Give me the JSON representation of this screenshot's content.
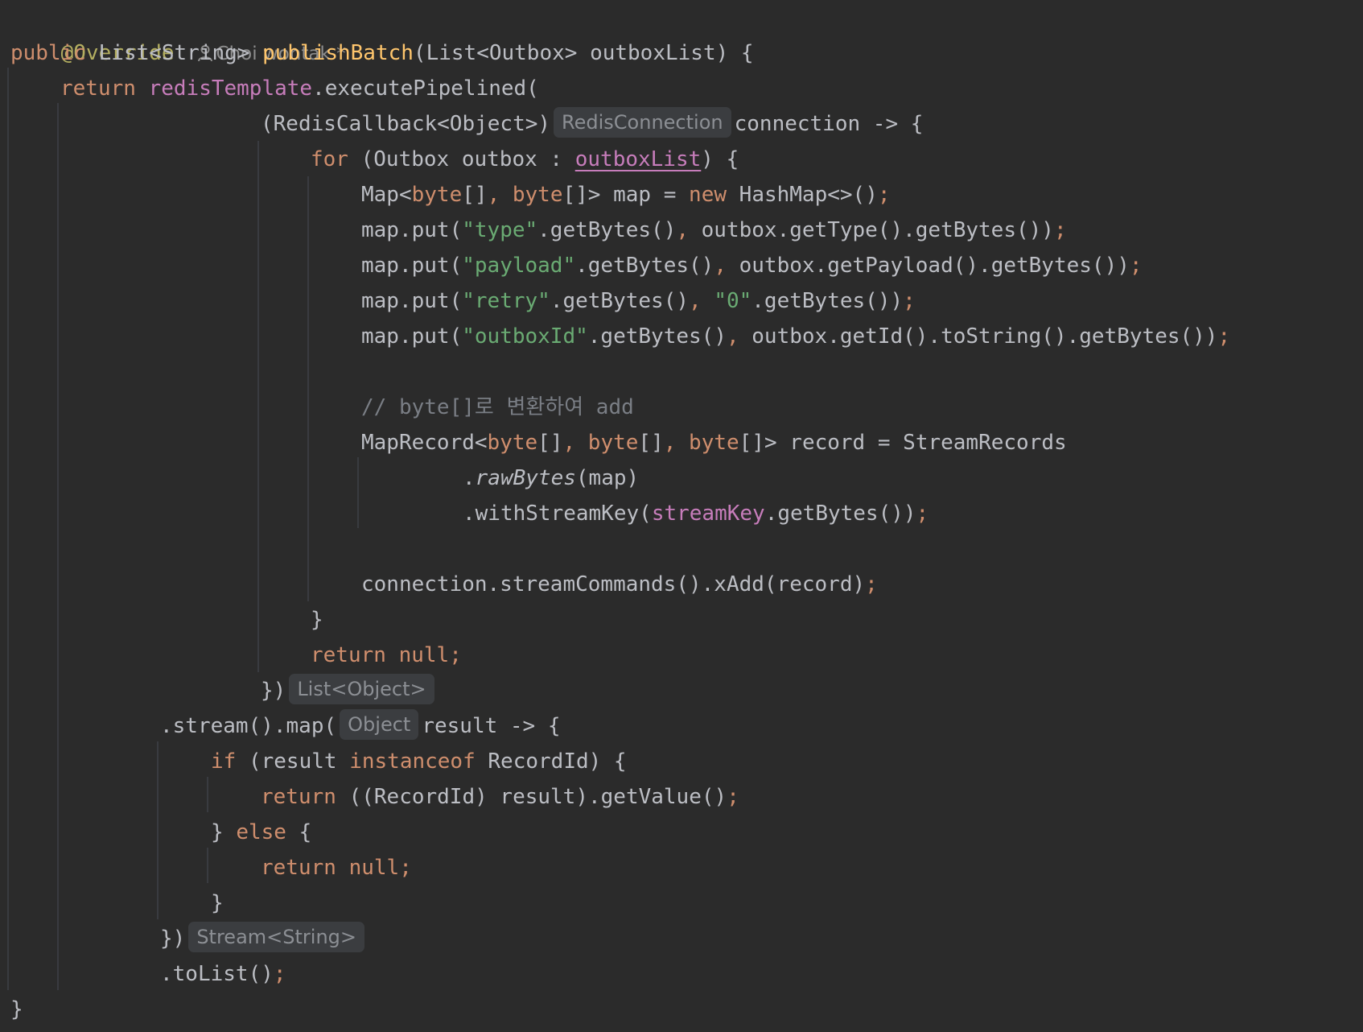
{
  "editor": {
    "colors": {
      "background": "#2b2b2b",
      "text": "#bcbec4",
      "keyword": "#cf8e6d",
      "method": "#ffc66d",
      "field": "#c77dbb",
      "string": "#6aab73",
      "comment": "#7a7e85",
      "annotation": "#b3ae60",
      "inlay_hint_bg": "#3b3d40"
    },
    "author_line": {
      "annotation": "@Override",
      "icon": "person-icon",
      "author": "Choi wontak *"
    },
    "lines": {
      "l1": {
        "kw": "public",
        "t1": " List<String> ",
        "fn": "publishBatch",
        "t2": "(List<Outbox> outboxList) {"
      },
      "l2": {
        "kw": "return",
        "sp": " ",
        "field": "redisTemplate",
        "t": ".executePipelined("
      },
      "l3": {
        "t1": "(RedisCallback<Object>)",
        "hint": "RedisConnection",
        "t2": "connection -> {"
      },
      "l4": {
        "kw": "for",
        "t1": " (Outbox outbox : ",
        "field": "outboxList",
        "t2": ") {"
      },
      "l5": {
        "t1": "Map<",
        "kw1": "byte",
        "t2": "[]",
        "p1": ", ",
        "kw2": "byte",
        "t3": "[]> map = ",
        "kw3": "new",
        "t4": " HashMap<>()",
        "semi": ";"
      },
      "l6": {
        "t1": "map.put(",
        "str": "\"type\"",
        "t2": ".getBytes()",
        "p": ", ",
        "t3": "outbox.getType().getBytes())",
        "semi": ";"
      },
      "l7": {
        "t1": "map.put(",
        "str": "\"payload\"",
        "t2": ".getBytes()",
        "p": ", ",
        "t3": "outbox.getPayload().getBytes())",
        "semi": ";"
      },
      "l8": {
        "t1": "map.put(",
        "str1": "\"retry\"",
        "t2": ".getBytes()",
        "p": ", ",
        "str2": "\"0\"",
        "t3": ".getBytes())",
        "semi": ";"
      },
      "l9": {
        "t1": "map.put(",
        "str": "\"outboxId\"",
        "t2": ".getBytes()",
        "p": ", ",
        "t3": "outbox.getId().toString().getBytes())",
        "semi": ";"
      },
      "l10": {
        "cmt": "// byte[]로 변환하여 add"
      },
      "l11": {
        "t1": "MapRecord<",
        "kw1": "byte",
        "t2": "[]",
        "p1": ", ",
        "kw2": "byte",
        "t3": "[]",
        "p2": ", ",
        "kw3": "byte",
        "t4": "[]> record = StreamRecords"
      },
      "l12": {
        "t1": ".",
        "it": "rawBytes",
        "t2": "(map)"
      },
      "l13": {
        "t1": ".withStreamKey(",
        "field": "streamKey",
        "t2": ".getBytes())",
        "semi": ";"
      },
      "l14": {
        "t": "connection.streamCommands().xAdd(record)",
        "semi": ";"
      },
      "l15": {
        "t": "}"
      },
      "l16": {
        "kw": "return null",
        "semi": ";"
      },
      "l17": {
        "t": "})",
        "hint": "List<Object>"
      },
      "l18": {
        "t1": ".stream().map(",
        "hint": "Object",
        "t2": "result -> {"
      },
      "l19": {
        "kw1": "if",
        "t1": " (result ",
        "kw2": "instanceof",
        "t2": " RecordId) {"
      },
      "l20": {
        "kw": "return",
        "t": " ((RecordId) result).getValue()",
        "semi": ";"
      },
      "l21": {
        "t1": "} ",
        "kw": "else",
        "t2": " {"
      },
      "l22": {
        "kw": "return null",
        "semi": ";"
      },
      "l23": {
        "t": "}"
      },
      "l24": {
        "t": "})",
        "hint": "Stream<String>"
      },
      "l25": {
        "t": ".toList()",
        "semi": ";"
      },
      "l26": {
        "t": "}"
      }
    }
  }
}
